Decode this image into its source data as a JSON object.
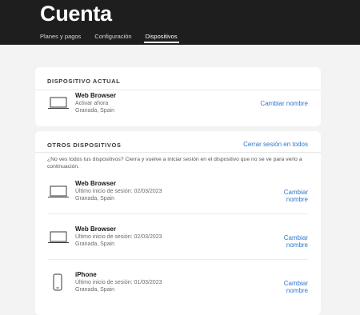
{
  "header": {
    "title": "Cuenta",
    "tabs": [
      {
        "label": "Planes y pagos",
        "active": false
      },
      {
        "label": "Configuración",
        "active": false
      },
      {
        "label": "Dispositivos",
        "active": true
      }
    ]
  },
  "current_device": {
    "section_title": "DISPOSITIVO ACTUAL",
    "name": "Web Browser",
    "status": "Activar ahora",
    "location": "Granada, Spain",
    "rename_label": "Cambiar nombre",
    "icon": "laptop-icon"
  },
  "other_devices": {
    "section_title": "OTROS DISPOSITIVOS",
    "sign_out_all_label": "Cerrar sesión en todos",
    "helper_text": "¿No ves todos tus dispositivos? Cierra y vuelve a iniciar sesión en el dispositivo que no se ve para verlo a continuación.",
    "rename_line1": "Cambiar",
    "rename_line2": "nombre",
    "devices": [
      {
        "name": "Web Browser",
        "last_login": "Último inicio de sesión: 02/03/2023",
        "location": "Granada, Spain",
        "icon": "laptop-icon"
      },
      {
        "name": "Web Browser",
        "last_login": "Último inicio de sesión: 02/03/2023",
        "location": "Granada, Spain",
        "icon": "laptop-icon"
      },
      {
        "name": "iPhone",
        "last_login": "Último inicio de sesión: 01/03/2023",
        "location": "Granada, Spain",
        "icon": "phone-icon"
      }
    ]
  },
  "colors": {
    "header_bg": "#1e1e1e",
    "page_bg": "#f3f3f3",
    "link": "#2e77d0"
  }
}
